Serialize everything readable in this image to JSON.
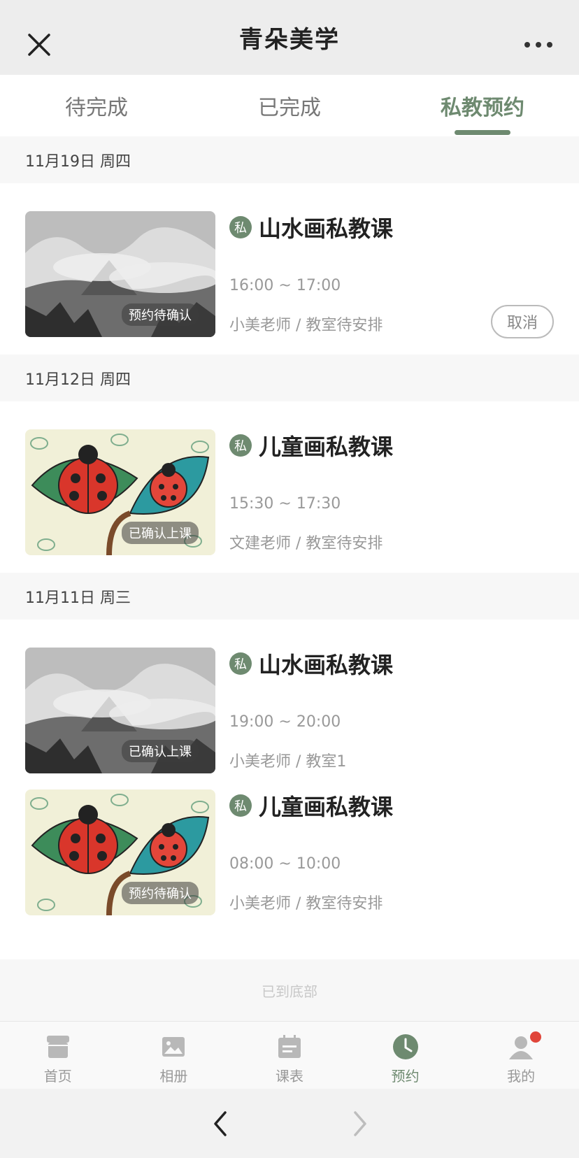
{
  "app": {
    "title": "青朵美学"
  },
  "tabs": [
    {
      "label": "待完成"
    },
    {
      "label": "已完成"
    },
    {
      "label": "私教预约"
    }
  ],
  "colors": {
    "accent": "#6e8a70",
    "badge_dot": "#e0453a"
  },
  "groups": [
    {
      "date": "11月19日 周四",
      "items": [
        {
          "badge": "私",
          "course": "山水画私教课",
          "time": "16:00 ~ 17:00",
          "teacher": "小美老师 / 教室待安排",
          "status": "预约待确认",
          "image": "landscape-painting",
          "cancel_label": "取消"
        }
      ]
    },
    {
      "date": "11月12日 周四",
      "items": [
        {
          "badge": "私",
          "course": "儿童画私教课",
          "time": "15:30 ~ 17:30",
          "teacher": "文建老师 / 教室待安排",
          "status": "已确认上课",
          "image": "ladybug-painting"
        }
      ]
    },
    {
      "date": "11月11日 周三",
      "items": [
        {
          "badge": "私",
          "course": "山水画私教课",
          "time": "19:00 ~ 20:00",
          "teacher": "小美老师 / 教室1",
          "status": "已确认上课",
          "image": "landscape-painting"
        },
        {
          "badge": "私",
          "course": "儿童画私教课",
          "time": "08:00 ~ 10:00",
          "teacher": "小美老师 / 教室待安排",
          "status": "预约待确认",
          "image": "ladybug-painting"
        }
      ]
    }
  ],
  "end_note": "已到底部",
  "bottom_nav": [
    {
      "label": "首页",
      "icon": "store-icon"
    },
    {
      "label": "相册",
      "icon": "image-icon"
    },
    {
      "label": "课表",
      "icon": "calendar-icon"
    },
    {
      "label": "预约",
      "icon": "clock-icon"
    },
    {
      "label": "我的",
      "icon": "user-icon"
    }
  ]
}
